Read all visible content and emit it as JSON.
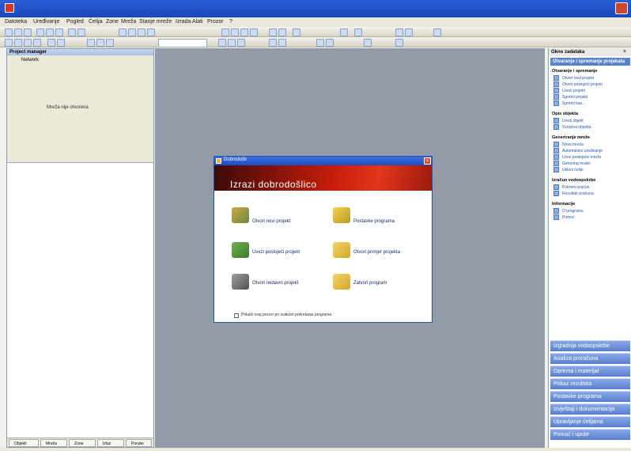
{
  "window": {
    "title": "",
    "close_glyph": ""
  },
  "menu": [
    {
      "label": "Datoteka"
    },
    {
      "label": "Uređivanje"
    },
    {
      "label": "Pogled"
    },
    {
      "label": "Ćelija"
    },
    {
      "label": "Zone"
    },
    {
      "label": "Mreža"
    },
    {
      "label": "Stanje mreže"
    },
    {
      "label": "Izrada"
    },
    {
      "label": "Alati"
    },
    {
      "label": "Prozor"
    },
    {
      "label": "?"
    }
  ],
  "left_panel": {
    "header": "Project manager",
    "tree_title": "Network",
    "tree_message": "Mreža nije otvorena",
    "tabs": [
      {
        "label": "Objekti"
      },
      {
        "label": "Mreža"
      },
      {
        "label": "Zone"
      },
      {
        "label": "Izlaz"
      },
      {
        "label": "Poruke"
      }
    ]
  },
  "right_panel": {
    "title": "Okno zadataka",
    "close": "×",
    "subtitle": "Otvaranje i spremanje projekata",
    "sections": [
      {
        "title": "Otvaranje i spremanje",
        "items": [
          "Otvori novi projekt",
          "Otvori postojeći projekt",
          "Uvezi projekt",
          "Spremi projekt",
          "Spremi kao..."
        ]
      },
      {
        "title": "Opis objekta",
        "items": [
          "Uredi objekt",
          "Svojstva objekta"
        ]
      },
      {
        "title": "Generiranje mreže",
        "items": [
          "Nova mreža",
          "Automatsko uređivanje",
          "Uvoz postojeće mreže",
          "Generiraj model",
          "Ukloni ćelije"
        ]
      },
      {
        "title": "Izračun vodoopskrbe",
        "items": [
          "Pokreni izračun",
          "Rezultati izračuna"
        ]
      },
      {
        "title": "Informacije",
        "items": [
          "O programu",
          "Pomoć"
        ]
      }
    ],
    "bottom_buttons": [
      "Izgradnja vodoopskrbe",
      "Analiza proračuna",
      "Oprema i materijal",
      "Prikaz rezultata",
      "Postavke programa",
      "Izvještaji i dokumentacija",
      "Upravljanje ćelijama",
      "Pomoć i upute"
    ]
  },
  "dialog": {
    "title": "Dobrodošli",
    "close": "×",
    "banner": "Izrazi dobrodošlico",
    "options": [
      {
        "label": "Otvori novi projekt"
      },
      {
        "label": "Uvezi postojeći projekt"
      },
      {
        "label": "Otvori nedavni projekt"
      },
      {
        "label": "Postavke programa"
      },
      {
        "label": "Otvori primjer projekta"
      },
      {
        "label": "Zatvori program"
      }
    ],
    "checkbox_label": "Prikaži ovaj prozor pri svakom pokretanju programa"
  },
  "colors": {
    "titlebar": "#1f4cc0",
    "workspace": "#949ba8",
    "banner": "#c81d0c",
    "accent": "#5b82cc"
  }
}
